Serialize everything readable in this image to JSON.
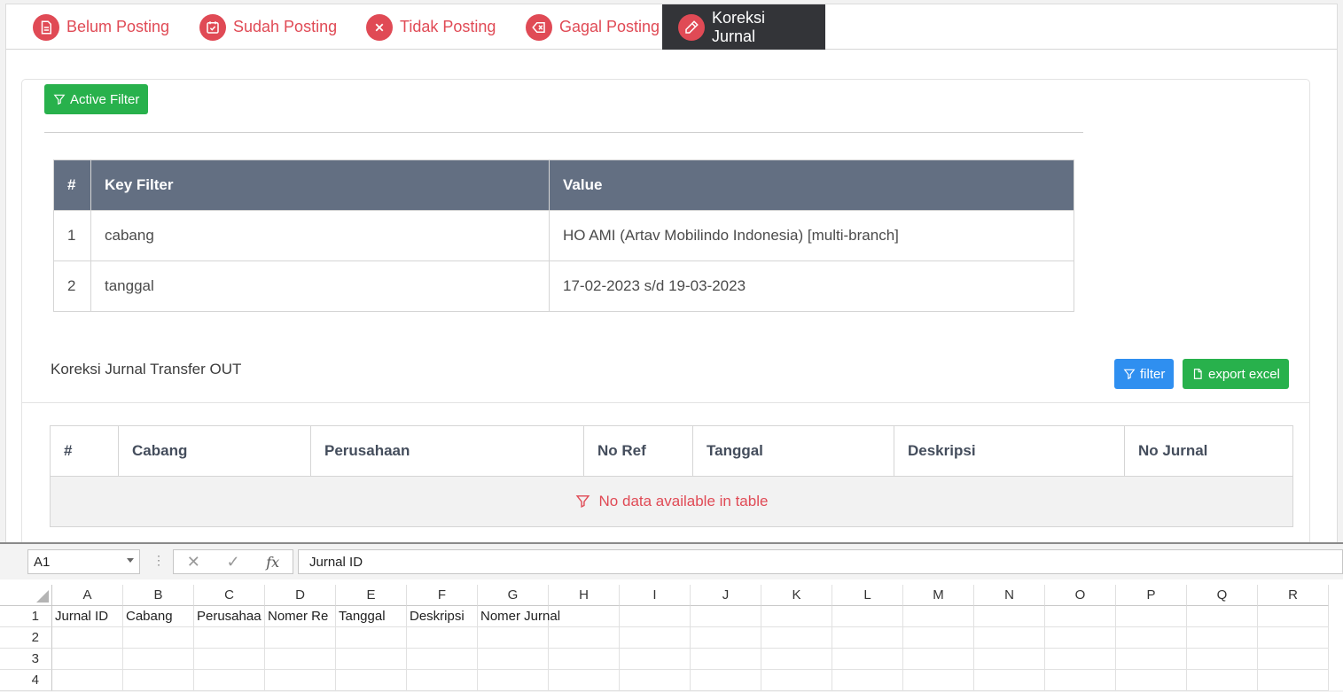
{
  "tabs": [
    {
      "label": "Belum Posting",
      "icon": "document-icon",
      "active": false
    },
    {
      "label": "Sudah Posting",
      "icon": "calendar-check-icon",
      "active": false
    },
    {
      "label": "Tidak Posting",
      "icon": "close-circle-icon",
      "active": false
    },
    {
      "label": "Gagal Posting",
      "icon": "backspace-icon",
      "active": false
    },
    {
      "label": "Koreksi Jurnal",
      "icon": "pencil-icon",
      "active": true
    }
  ],
  "active_filter_label": "Active Filter",
  "filter_table": {
    "headers": [
      "#",
      "Key Filter",
      "Value"
    ],
    "rows": [
      [
        "1",
        "cabang",
        "HO AMI (Artav Mobilindo Indonesia) [multi-branch]"
      ],
      [
        "2",
        "tanggal",
        "17-02-2023 s/d 19-03-2023"
      ]
    ]
  },
  "section_title": "Koreksi Jurnal Transfer OUT",
  "buttons": {
    "filter": "filter",
    "export": "export excel"
  },
  "data_table": {
    "headers": [
      "#",
      "Cabang",
      "Perusahaan",
      "No Ref",
      "Tanggal",
      "Deskripsi",
      "No Jurnal"
    ],
    "empty_message": "No data available in table"
  },
  "excel": {
    "name_box": "A1",
    "formula": "Jurnal ID",
    "columns": [
      "A",
      "B",
      "C",
      "D",
      "E",
      "F",
      "G",
      "H",
      "I",
      "J",
      "K",
      "L",
      "M",
      "N",
      "O",
      "P",
      "Q",
      "R"
    ],
    "row_numbers": [
      "1",
      "2",
      "3",
      "4"
    ],
    "row1": [
      "Jurnal ID",
      "Cabang",
      "Perusahaa",
      "Nomer Re",
      "Tanggal",
      "Deskripsi",
      "Nomer Jurnal"
    ]
  },
  "colors": {
    "accent_red": "#e04a55",
    "green": "#28b14c",
    "blue": "#2f8ff0",
    "header_slate": "#636f82",
    "tab_dark": "#333438"
  }
}
